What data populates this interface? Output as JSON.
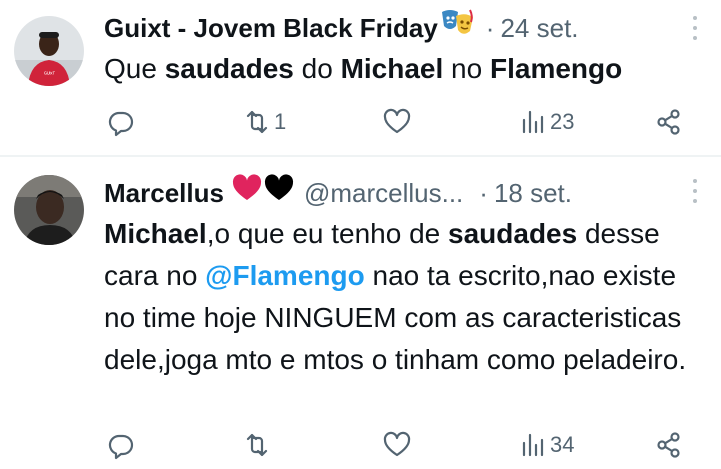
{
  "tweets": [
    {
      "name": "Guixt - Jovem Black Friday",
      "handle": "",
      "date": "24 set.",
      "date_dot": "·",
      "text_parts": [
        "Que ",
        "saudades",
        " do ",
        "Michael",
        " no ",
        "Flamengo"
      ],
      "replies": "",
      "reposts": "1",
      "likes": "",
      "views": "23"
    },
    {
      "name": "Marcellus",
      "handle": "@marcellus...",
      "date": "18 set.",
      "date_dot": "·",
      "text_parts": [
        "Michael",
        ",o que eu tenho de ",
        "saudades",
        " desse cara no ",
        "@Flamengo",
        " nao ta escrito,nao existe no time hoje NINGUEM com as caracteristicas dele,joga mto e mtos o tinham como peladeiro."
      ],
      "replies": "",
      "reposts": "",
      "likes": "",
      "views": "34"
    }
  ],
  "icons": {
    "reply": "reply-icon",
    "repost": "repost-icon",
    "like": "heart-icon",
    "views": "views-icon",
    "share": "share-icon",
    "more": "more-icon"
  },
  "colors": {
    "text": "#0f1419",
    "secondary": "#536471",
    "link": "#1d9bf0",
    "heart_red": "#e0245e",
    "heart_black": "#000000"
  }
}
